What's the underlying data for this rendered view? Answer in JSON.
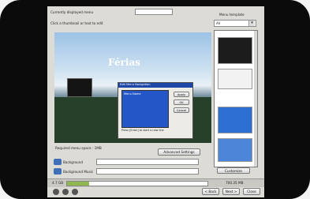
{
  "window": {
    "currently_displayed_menu_label": "Currently displayed menu",
    "menu_name_value": "",
    "thumbnail_hint": "Click a thumbnail or text to edit",
    "menu_template_label": "Menu template",
    "template_select_value": "All",
    "preview_title": "Férias",
    "required_space_label": "Required menu space : 1MB",
    "advanced_settings_label": "Advanced Settings",
    "background_label": "Background",
    "background_music_label": "Background Music",
    "customize_label": "Customize",
    "back_label": "< Back",
    "next_label": "Next >",
    "close_label": "Close",
    "status_left": "4.7 GB",
    "status_right": "700.35 MB"
  },
  "dialog": {
    "title": "Edit Menu Navigation",
    "list_header": "Menu Name",
    "ok_label": "OK",
    "cancel_label": "Cancel",
    "apply_label": "Apply",
    "hint": "Press [Enter] to start a new line"
  },
  "colors": {
    "frame": "#0b0b0b",
    "window": "#dcdbd6",
    "dialog_title": "#1f47a8",
    "dialog_list": "#2456c8"
  }
}
